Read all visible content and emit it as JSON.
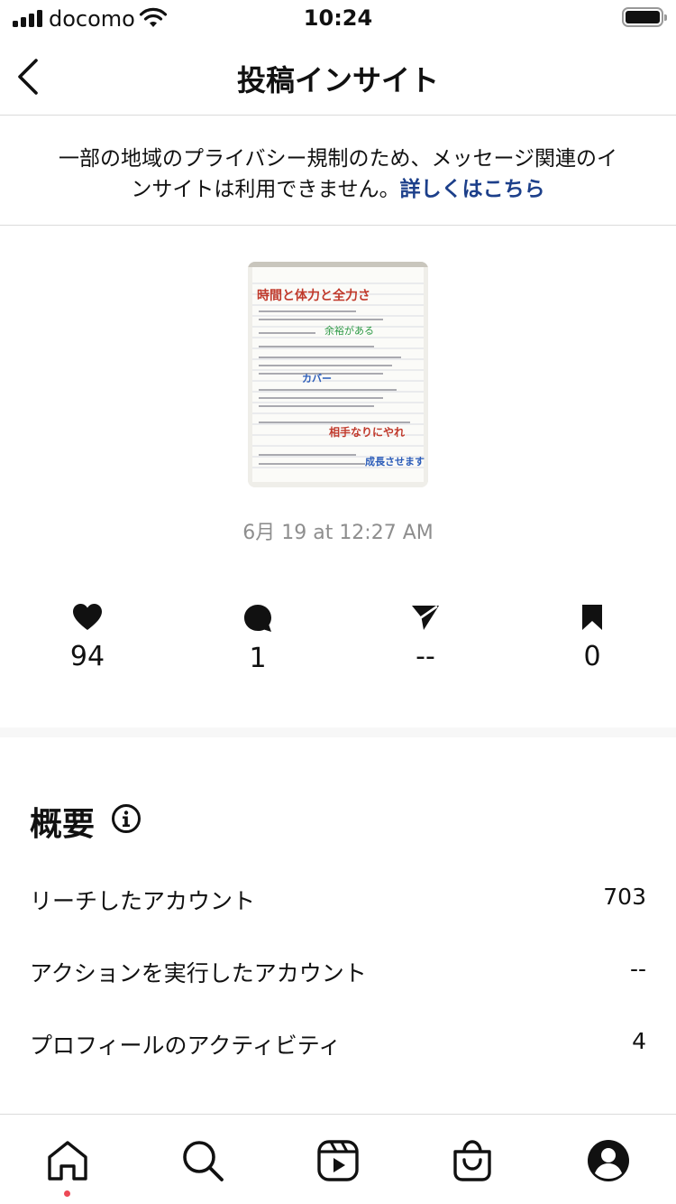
{
  "status_bar": {
    "carrier": "docomo",
    "time": "10:24"
  },
  "nav": {
    "title": "投稿インサイト",
    "back_icon": "chevron-left-icon"
  },
  "notice": {
    "text": "一部の地域のプライバシー規制のため、メッセージ関連のインサイトは利用できません。",
    "link": "詳しくはこちら"
  },
  "post": {
    "thumbnail_lines": {
      "title": "時間と体力と全力さ",
      "green": "余裕がある",
      "blue": "カバー",
      "red": "相手なりにやれ",
      "blue2": "成長させます"
    },
    "date": "6月 19 at 12:27 AM"
  },
  "stats": {
    "likes": "94",
    "comments": "1",
    "shares": "--",
    "saves": "0"
  },
  "overview": {
    "title": "概要",
    "rows": [
      {
        "label": "リーチしたアカウント",
        "value": "703"
      },
      {
        "label": "アクションを実行したアカウント",
        "value": "--"
      },
      {
        "label": "プロフィールのアクティビティ",
        "value": "4"
      }
    ]
  },
  "tabbar": {
    "accent": "#ed4956"
  }
}
